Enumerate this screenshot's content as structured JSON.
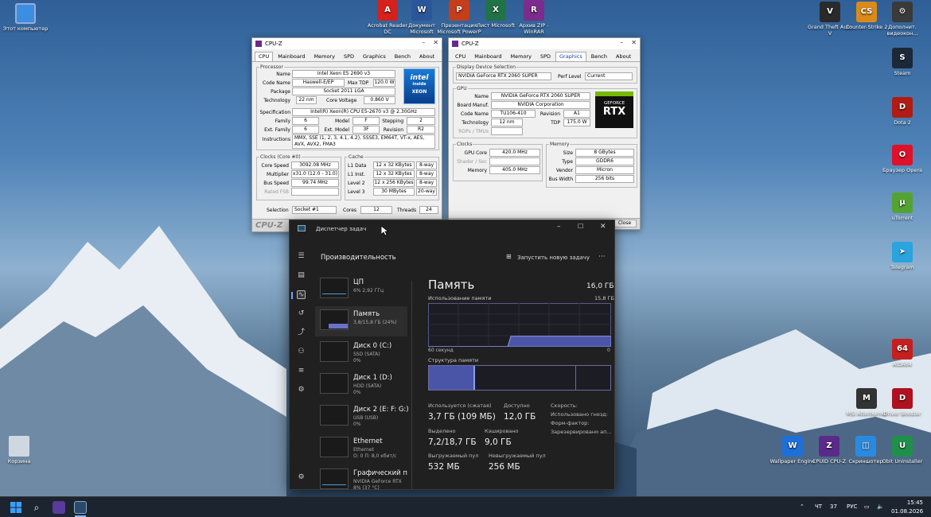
{
  "desktop": {
    "left": [
      {
        "label": "Этот компьютер",
        "icon": "computer-icon"
      },
      {
        "label": "Корзина",
        "icon": "recycle-bin-icon"
      }
    ],
    "top": [
      {
        "label": "Acrobat Reader DC",
        "glyph": "A",
        "color": "#d4211b"
      },
      {
        "label": "Документ Microsoft",
        "glyph": "W",
        "color": "#2b579a"
      },
      {
        "label": "Презентация Microsoft PowerP",
        "glyph": "P",
        "color": "#c43e1c"
      },
      {
        "label": "Лист Microsoft",
        "glyph": "X",
        "color": "#217346"
      },
      {
        "label": "Архив ZIP - WinRAR",
        "glyph": "R",
        "color": "#7b2c8c"
      }
    ],
    "right": [
      {
        "label": "Grand Theft Auto V",
        "glyph": "V",
        "color": "#2a2a2a"
      },
      {
        "label": "Counter-Strike 2",
        "glyph": "CS",
        "color": "#d98a1a"
      },
      {
        "label": "Дополнит. видеокон...",
        "glyph": "⚙",
        "color": "#3a3a3a"
      },
      {
        "label": "Steam",
        "glyph": "S",
        "color": "#1b2838"
      },
      {
        "label": "Dota 2",
        "glyph": "D",
        "color": "#b01c13"
      },
      {
        "label": "Браузер Opera",
        "glyph": "O",
        "color": "#e0102a"
      },
      {
        "label": "uTorrent",
        "glyph": "µ",
        "color": "#54a332"
      },
      {
        "label": "Telegram",
        "glyph": "➤",
        "color": "#2aa3df"
      },
      {
        "label": "AIDA64",
        "glyph": "64",
        "color": "#c51f1f"
      },
      {
        "label": "MSI Afterburner",
        "glyph": "M",
        "color": "#333"
      },
      {
        "label": "Driver Booster",
        "glyph": "D",
        "color": "#b01020"
      },
      {
        "label": "Wallpaper Engine",
        "glyph": "W",
        "color": "#1f6fd8"
      },
      {
        "label": "CPUID CPU-Z",
        "glyph": "Z",
        "color": "#5a2a8a"
      },
      {
        "label": "Скриншотер",
        "glyph": "◫",
        "color": "#2a8ae0"
      },
      {
        "label": "Obit Uninstaller",
        "glyph": "U",
        "color": "#1f8f4a"
      }
    ]
  },
  "cpuz1": {
    "title": "CPU-Z",
    "tabs": [
      "CPU",
      "Mainboard",
      "Memory",
      "SPD",
      "Graphics",
      "Bench",
      "About"
    ],
    "proc_legend": "Processor",
    "name_l": "Name",
    "name": "Intel Xeon E5 2690 v3",
    "code_l": "Code Name",
    "code": "Haswell-E/EP",
    "tdp_l": "Max TDP",
    "tdp": "120.0 W",
    "pkg_l": "Package",
    "pkg": "Socket 2011 LGA",
    "tech_l": "Technology",
    "tech": "22 nm",
    "cv_l": "Core Voltage",
    "cv": "0.860 V",
    "spec_l": "Specification",
    "spec": "Intel(R) Xeon(R) CPU E5-2670 v3 @ 2.30GHz",
    "fam_l": "Family",
    "fam": "6",
    "model_l": "Model",
    "model": "F",
    "step_l": "Stepping",
    "step": "2",
    "efam_l": "Ext. Family",
    "efam": "6",
    "emodel_l": "Ext. Model",
    "emodel": "3F",
    "rev_l": "Revision",
    "rev": "R2",
    "inst_l": "Instructions",
    "inst": "MMX, SSE (1, 2, 3, 4.1, 4.2), SSSE3, EM64T, VT-x, AES, AVX, AVX2, FMA3",
    "logo_top": "intel",
    "logo_mid": "inside",
    "logo_bot": "XEON",
    "clk_legend": "Clocks (Core #0)",
    "cs_l": "Core Speed",
    "cs": "3092.08 MHz",
    "mul_l": "Multiplier",
    "mul": "x31.0 (12.0 - 31.0)",
    "bus_l": "Bus Speed",
    "bus": "99.74 MHz",
    "fsb_l": "Rated FSB",
    "cache_legend": "Cache",
    "l1d_l": "L1 Data",
    "l1d": "12 x 32 KBytes",
    "l1d_w": "8-way",
    "l1i_l": "L1 Inst.",
    "l1i": "12 x 32 KBytes",
    "l1i_w": "8-way",
    "l2_l": "Level 2",
    "l2": "12 x 256 KBytes",
    "l2_w": "8-way",
    "l3_l": "Level 3",
    "l3": "30 MBytes",
    "l3_w": "20-way",
    "sel_l": "Selection",
    "sel": "Socket #1",
    "cores_l": "Cores",
    "cores": "12",
    "thr_l": "Threads",
    "thr": "24",
    "brand": "CPU-Z"
  },
  "cpuz2": {
    "title": "CPU-Z",
    "tabs": [
      "CPU",
      "Mainboard",
      "Memory",
      "SPD",
      "Graphics",
      "Bench",
      "About"
    ],
    "dds_legend": "Display Device Selection",
    "dev": "NVIDIA GeForce RTX 2060 SUPER",
    "perf_l": "Perf Level",
    "perf": "Current",
    "gpu_legend": "GPU",
    "name_l": "Name",
    "name": "NVIDIA GeForce RTX 2060 SUPER",
    "bm_l": "Board Manuf.",
    "bm": "NVIDIA Corporation",
    "code_l": "Code Name",
    "code": "TU106-410",
    "rev_l": "Revision",
    "rev": "A1",
    "tech_l": "Technology",
    "tech": "12 nm",
    "tdp_l": "TDP",
    "tdp": "175.0 W",
    "rops_l": "ROPs / TMUs",
    "logo_a": "GEFORCE",
    "logo_b": "RTX",
    "clk_legend": "Clocks",
    "gc_l": "GPU Core",
    "gc": "420.0 MHz",
    "sh_l": "Shader / Sec",
    "mem_l": "Memory",
    "mem": "405.0 MHz",
    "m_legend": "Memory",
    "size_l": "Size",
    "size": "8 GBytes",
    "type_l": "Type",
    "type": "GDDR6",
    "vend_l": "Vendor",
    "vend": "Micron",
    "bw_l": "Bus Width",
    "bw": "256 bits",
    "close": "Close"
  },
  "tm": {
    "title": "Диспетчер задач",
    "header": "Производительность",
    "run": "Запустить новую задачу",
    "more": "···",
    "items": [
      {
        "name": "ЦП",
        "s1": "6% 2,92 ГГц",
        "s2": ""
      },
      {
        "name": "Память",
        "s1": "3,8/15,8 ГБ (24%)",
        "s2": ""
      },
      {
        "name": "Диск 0 (C:)",
        "s1": "SSD (SATA)",
        "s2": "0%"
      },
      {
        "name": "Диск 1 (D:)",
        "s1": "HDD (SATA)",
        "s2": "0%"
      },
      {
        "name": "Диск 2 (E: F: G:)",
        "s1": "USB (USB)",
        "s2": "0%"
      },
      {
        "name": "Ethernet",
        "s1": "Ethernet",
        "s2": "О: 0 П: 8,0 кбит/с"
      },
      {
        "name": "Графический п",
        "s1": "NVIDIA GeForce RTX",
        "s2": "8% (37 °C)"
      }
    ],
    "mem_title": "Память",
    "mem_total": "16,0 ГБ",
    "usage_l": "Использование памяти",
    "usage_max": "15,8 ГБ",
    "sec_l": "60 секунд",
    "zero": "0",
    "struct_l": "Структура памяти",
    "used_fraction": 0.24,
    "stats": {
      "inuse_l": "Используется (сжатая)",
      "inuse": "3,7 ГБ (109 МБ)",
      "avail_l": "Доступно",
      "avail": "12,0 ГБ",
      "speed_l": "Скорость:",
      "slots_l": "Использовано гнезд:",
      "ff_l": "Форм-фактор:",
      "res_l": "Зарезервировано ап...",
      "commit_l": "Выделено",
      "commit": "7,2/18,7 ГБ",
      "cached_l": "Кэшировано",
      "cached": "9,0 ГБ",
      "paged_l": "Выгружаемый пул",
      "paged": "532 МБ",
      "nonpaged_l": "Невыгружаемый пул",
      "nonpaged": "256 МБ"
    }
  },
  "taskbar": {
    "lang": "РУС",
    "day": "ЧТ",
    "num": "37",
    "time": "15:45",
    "date": "01.08.2026"
  }
}
